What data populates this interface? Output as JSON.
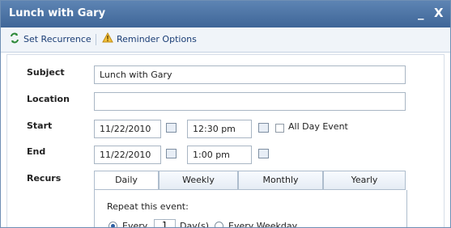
{
  "window": {
    "title": "Lunch with Gary",
    "minimize_label": "_",
    "close_label": "X"
  },
  "toolbar": {
    "recurrence_label": "Set Recurrence",
    "reminder_label": "Reminder Options",
    "recurrence_icon": "recurrence-icon",
    "reminder_icon": "warning-icon"
  },
  "form": {
    "subject_label": "Subject",
    "subject_value": "Lunch with Gary",
    "location_label": "Location",
    "location_value": "",
    "start_label": "Start",
    "start_date": "11/22/2010",
    "start_time": "12:30 pm",
    "all_day_label": "All Day Event",
    "end_label": "End",
    "end_date": "11/22/2010",
    "end_time": "1:00 pm",
    "recurs_label": "Recurs"
  },
  "tabs": [
    {
      "label": "Daily"
    },
    {
      "label": "Weekly"
    },
    {
      "label": "Monthly"
    },
    {
      "label": "Yearly"
    }
  ],
  "recurrence": {
    "repeat_label": "Repeat this event:",
    "every_label": "Every",
    "every_value": "1",
    "days_label": "Day(s)",
    "weekday_label": "Every Weekday"
  },
  "colors": {
    "title_bar": "#4a71a3",
    "toolbar_bg": "#f0f4f9",
    "link_text": "#1a3d75"
  }
}
